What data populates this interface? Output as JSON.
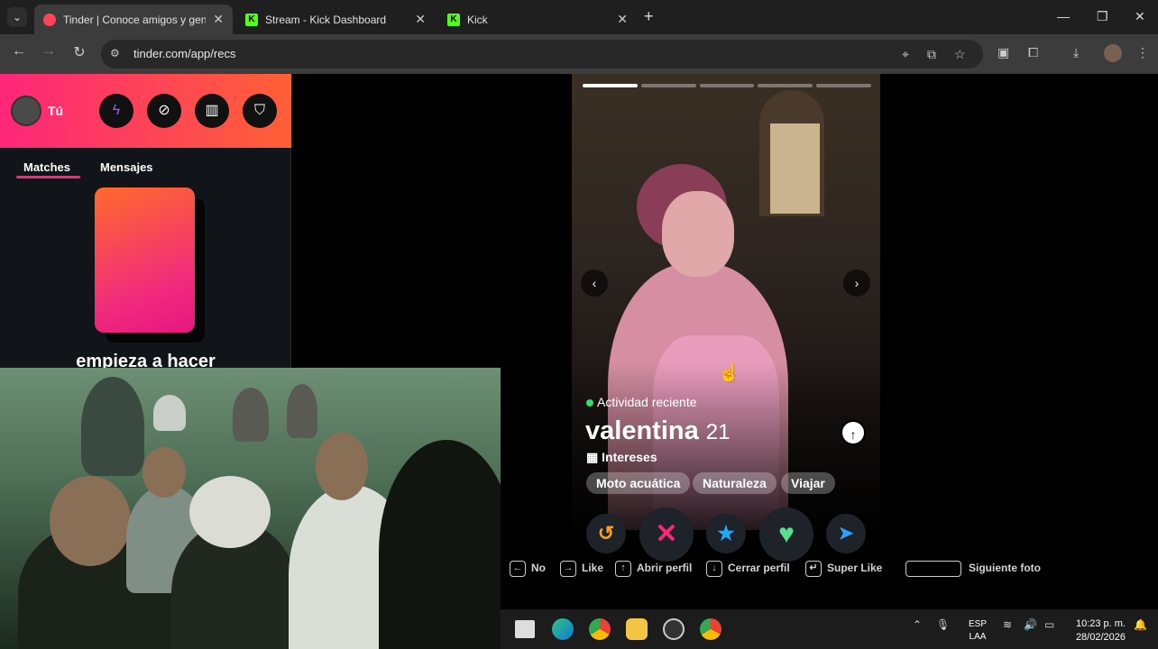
{
  "browser": {
    "tabs": [
      {
        "title": "Tinder | Conoce amigos y gente",
        "favicon": "tinder-flame-icon",
        "active": true
      },
      {
        "title": "Stream - Kick Dashboard",
        "favicon": "kick-icon",
        "active": false
      },
      {
        "title": "Kick",
        "favicon": "kick-icon",
        "active": false
      }
    ],
    "new_tab_label": "+",
    "url": "tinder.com/app/recs"
  },
  "sidebar": {
    "user_label": "Tú",
    "tabs": [
      "Matches",
      "Mensajes"
    ],
    "cta_text": "empieza a hacer"
  },
  "profile": {
    "activity": "Actividad reciente",
    "name": "valentina",
    "age": "21",
    "interests_label": "Intereses",
    "interests": [
      "Moto acuática",
      "Naturaleza",
      "Viajar"
    ],
    "photo_count": 5,
    "current_photo": 1
  },
  "shortcuts": [
    {
      "key": "←",
      "label": "No"
    },
    {
      "key": "→",
      "label": "Like"
    },
    {
      "key": "↑",
      "label": "Abrir perfil"
    },
    {
      "key": "↓",
      "label": "Cerrar perfil"
    },
    {
      "key": "↵",
      "label": "Super Like"
    },
    {
      "key": "",
      "label": "Siguiente foto"
    }
  ],
  "taskbar": {
    "lang_top": "ESP",
    "lang_bottom": "LAA",
    "time": "10:23 p. m.",
    "date": "28/02/2026"
  },
  "colors": {
    "tinder_gradient_start": "#fd267a",
    "tinder_gradient_end": "#ff6036",
    "rewind": "#f7a120",
    "nope": "#fd267a",
    "super_like": "#1ea7fd",
    "like": "#57e08f",
    "boost": "#2ea0ff",
    "online": "#2ee067"
  }
}
